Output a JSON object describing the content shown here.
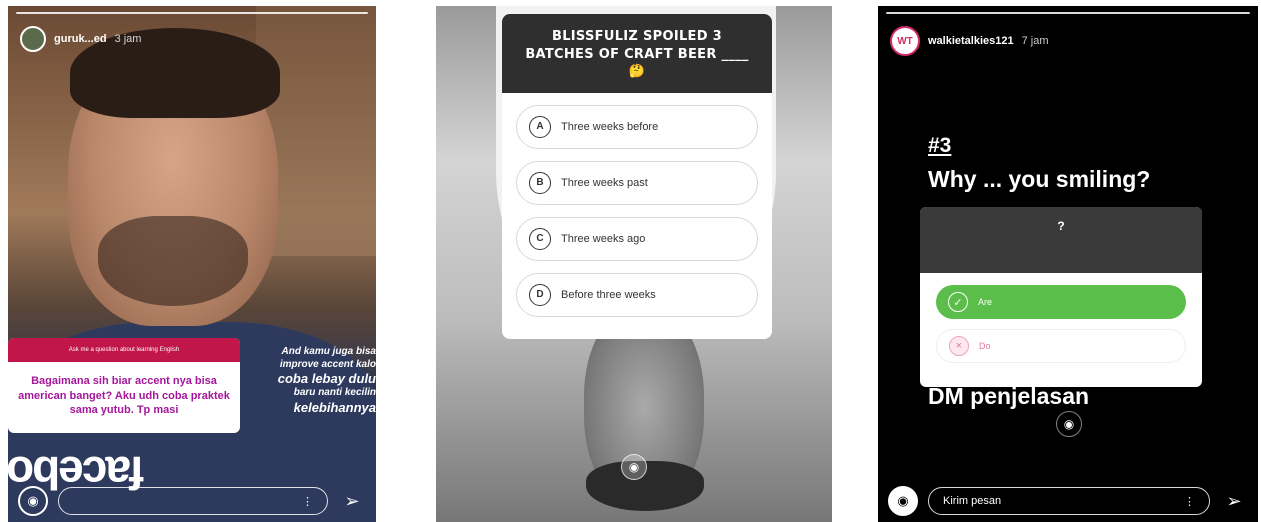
{
  "story1": {
    "username": "guruk...ed",
    "time": "3 jam",
    "question_header": "Ask me a question about learning English",
    "question_body": "Bagaimana sih biar accent nya bisa american banget? Aku udh coba praktek sama yutub. Tp masi",
    "side_text_1": "And kamu juga bisa improve accent kalo",
    "side_text_2": "coba lebay dulu",
    "side_text_3": "baru nanti kecilin",
    "side_text_4": "kelebihannya",
    "big_word": "facebo",
    "camera_icon": "camera-icon",
    "send_icon": "send-icon"
  },
  "story2": {
    "quiz_title": "BLISSFULIZ SPOILED 3 BATCHES OF CRAFT BEER ____ 🤔",
    "options": [
      {
        "letter": "A",
        "text": "Three weeks before"
      },
      {
        "letter": "B",
        "text": "Three weeks past"
      },
      {
        "letter": "C",
        "text": "Three weeks ago"
      },
      {
        "letter": "D",
        "text": "Before three weeks"
      }
    ]
  },
  "story3": {
    "avatar_text": "WT",
    "username": "walkietalkies121",
    "time": "7 jam",
    "number": "#3",
    "question": "Why ... you smiling?",
    "poll_title": "?",
    "poll_options": [
      "Are",
      "Do"
    ],
    "dm_text": "DM penjelasan",
    "message_placeholder": "Kirim pesan"
  },
  "colors": {
    "question_header_bg": "#c0164a",
    "question_text": "#a4179a",
    "poll_correct": "#5bbd4a",
    "poll_wrong": "#e57b9a"
  }
}
